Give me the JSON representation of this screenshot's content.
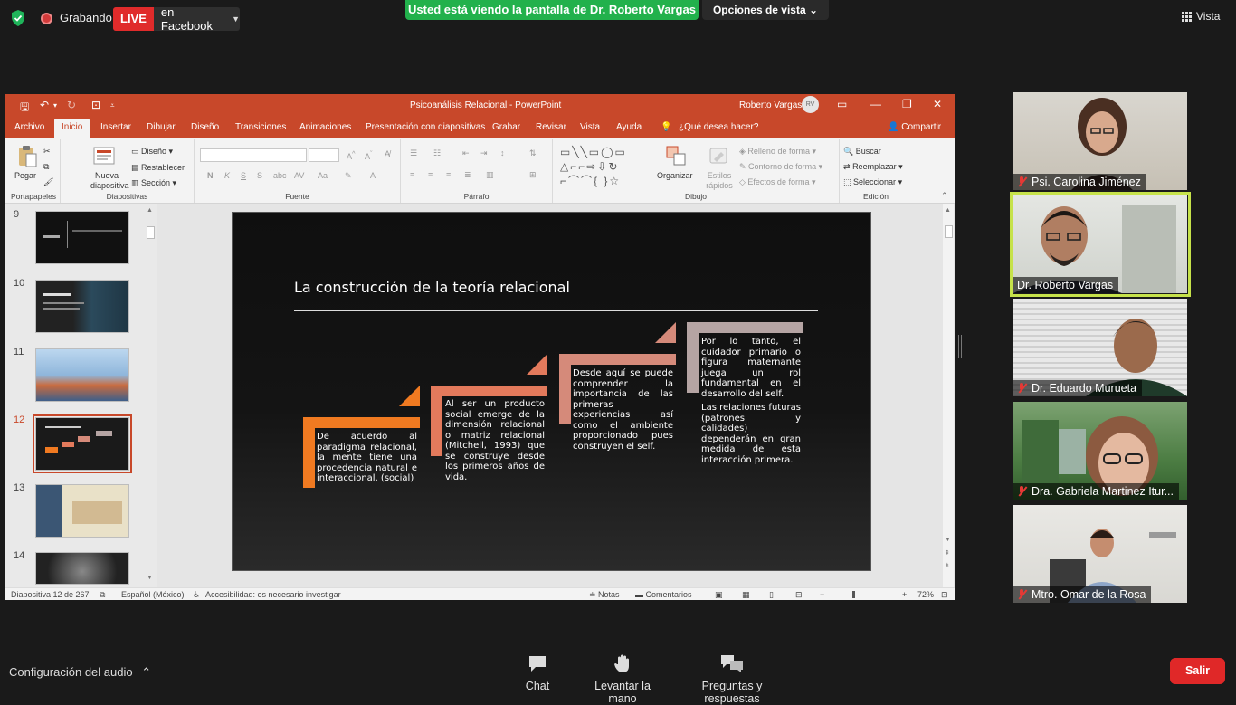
{
  "zoom": {
    "recording_label": "Grabando",
    "live_badge": "LIVE",
    "live_target": "en Facebook",
    "share_banner": "Usted está viendo la pantalla de Dr. Roberto Vargas",
    "view_options": "Opciones de vista",
    "view_label": "Vista",
    "audio_settings": "Configuración del audio",
    "toolbar": {
      "chat": "Chat",
      "raise_hand": "Levantar la mano",
      "qa": "Preguntas y respuestas"
    },
    "leave": "Salir",
    "accent_green": "#22b14c",
    "live_red": "#e02b2b"
  },
  "participants": [
    {
      "name": "Psi. Carolina Jiménez",
      "muted": true
    },
    {
      "name": "Dr. Roberto Vargas",
      "muted": false,
      "speaking": true
    },
    {
      "name": "Dr. Eduardo Murueta",
      "muted": true
    },
    {
      "name": "Dra. Gabriela Martinez Itur...",
      "muted": true
    },
    {
      "name": "Mtro. Omar de la Rosa",
      "muted": true
    }
  ],
  "ppt": {
    "doc_title": "Psicoanálisis Relacional  -  PowerPoint",
    "user": "Roberto Vargas",
    "user_initials": "RV",
    "accent": "#c8482a",
    "tabs": [
      "Archivo",
      "Inicio",
      "Insertar",
      "Dibujar",
      "Diseño",
      "Transiciones",
      "Animaciones",
      "Presentación con diapositivas",
      "Grabar",
      "Revisar",
      "Vista",
      "Ayuda"
    ],
    "tell_me": "¿Qué desea hacer?",
    "share": "Compartir",
    "ribbon": {
      "paste": "Pegar",
      "clipboard": "Portapapeles",
      "new_slide": "Nueva diapositiva",
      "layout": "Diseño",
      "reset": "Restablecer",
      "section": "Sección",
      "slides": "Diapositivas",
      "font": "Fuente",
      "paragraph": "Párrafo",
      "arrange": "Organizar",
      "quick_styles": "Estilos rápidos",
      "shape_fill": "Relleno de forma",
      "shape_outline": "Contorno de forma",
      "shape_effects": "Efectos de forma",
      "drawing": "Dibujo",
      "find": "Buscar",
      "replace": "Reemplazar",
      "select": "Seleccionar",
      "editing": "Edición"
    },
    "thumbnail_numbers": [
      "9",
      "10",
      "11",
      "12",
      "13",
      "14"
    ],
    "selected_slide": "12",
    "slide": {
      "title": "La construcción de la teoría relacional",
      "steps": [
        "De acuerdo al paradigma relacional, la mente tiene una procedencia natural e interaccional. (social)",
        "Al ser un producto social emerge de la dimensión relacional o matriz relacional (Mitchell, 1993) que se construye desde los primeros años de vida.",
        "Desde aquí se puede comprender la importancia de las primeras experiencias así como el ambiente proporcionado pues construyen el self.",
        "Por lo tanto, el cuidador primario o figura maternante juega un rol fundamental en el desarrollo del self."
      ],
      "step4_extra": "Las relaciones futuras (patrones y calidades) dependerán en gran medida de esta interacción primera.",
      "step_colors": [
        "#f07a21",
        "#e37a5c",
        "#d58a7a",
        "#b5a4a3"
      ]
    },
    "status": {
      "slide_info": "Diapositiva 12 de 267",
      "language": "Español (México)",
      "accessibility": "Accesibilidad: es necesario investigar",
      "notes": "Notas",
      "comments": "Comentarios",
      "zoom": "72%"
    }
  }
}
